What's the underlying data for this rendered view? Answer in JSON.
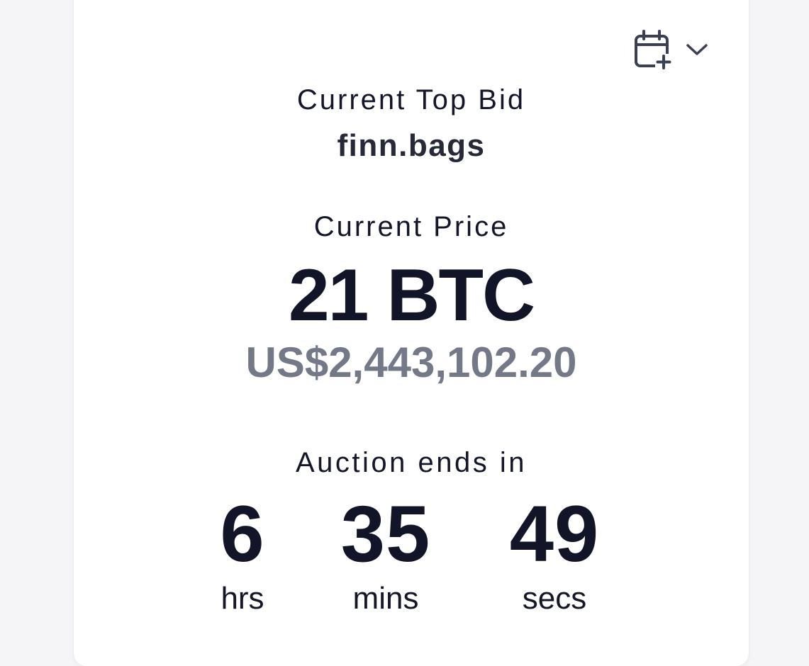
{
  "header": {
    "calendar_icon": "calendar-plus-icon",
    "dropdown_icon": "chevron-down-icon"
  },
  "top_bid": {
    "label": "Current Top Bid",
    "bidder": "finn.bags"
  },
  "price": {
    "label": "Current Price",
    "btc": "21 BTC",
    "usd": "US$2,443,102.20"
  },
  "auction": {
    "label": "Auction ends in",
    "hours": "6",
    "hours_label": "hrs",
    "minutes": "35",
    "minutes_label": "mins",
    "seconds": "49",
    "seconds_label": "secs"
  },
  "colors": {
    "text_primary": "#121527",
    "text_secondary": "#747988",
    "card_bg": "#ffffff"
  }
}
